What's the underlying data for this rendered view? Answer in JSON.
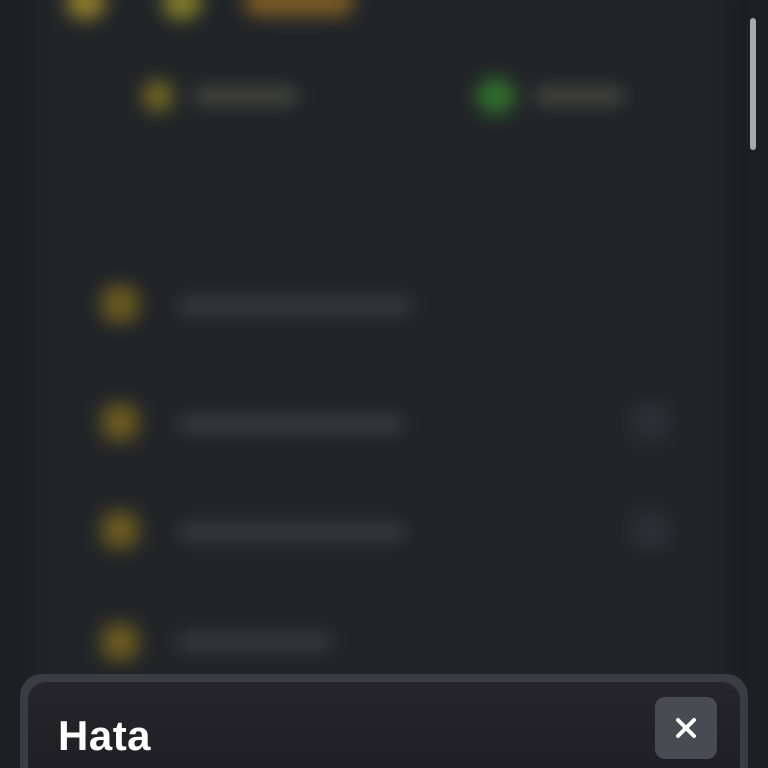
{
  "modal": {
    "title": "Hata",
    "close_icon": "close-icon"
  },
  "theme": {
    "background": "#1d2023",
    "sheet": "#26252c",
    "sheet_border": "#3b3b42",
    "close_button": "#4a4a53",
    "accent_yellow": "#c9a227",
    "accent_green": "#3fae2a"
  }
}
